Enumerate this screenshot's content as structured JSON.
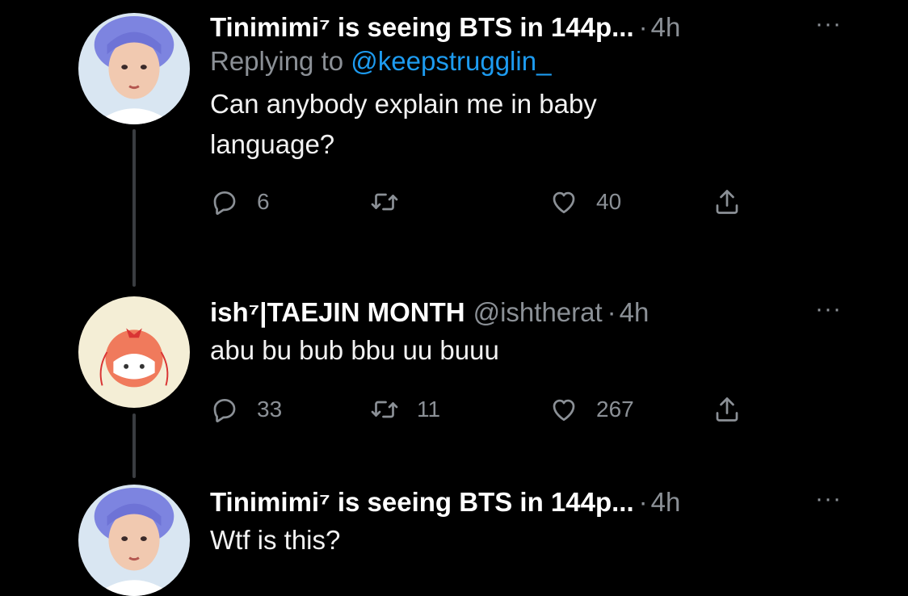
{
  "tweets": [
    {
      "display_name": "Tinimimi⁷ is seeing BTS in 144p...",
      "dot": "·",
      "time": "4h",
      "more": "···",
      "replying_prefix": "Replying to",
      "replying_handle": "@keepstrugglin_",
      "text_lines": [
        "Can anybody explain me in baby",
        "language?"
      ],
      "replies": "6",
      "likes": "40"
    },
    {
      "display_name": "ish⁷|TAEJIN MONTH",
      "handle": "@ishtherat",
      "dot": "·",
      "time": "4h",
      "more": "···",
      "text_lines": [
        "abu bu bub bbu uu buuu"
      ],
      "replies": "33",
      "retweets": "11",
      "likes": "267"
    },
    {
      "display_name": "Tinimimi⁷ is seeing BTS in 144p...",
      "dot": "·",
      "time": "4h",
      "more": "···",
      "text_lines": [
        "Wtf is this?"
      ]
    }
  ],
  "colors": {
    "background": "#000000",
    "text": "#e7e9ea",
    "secondary": "#8b9096",
    "link": "#1d9bf0",
    "thread_line": "#3a3d41"
  },
  "icons": [
    "reply-icon",
    "retweet-icon",
    "like-icon",
    "share-icon",
    "more-icon"
  ]
}
